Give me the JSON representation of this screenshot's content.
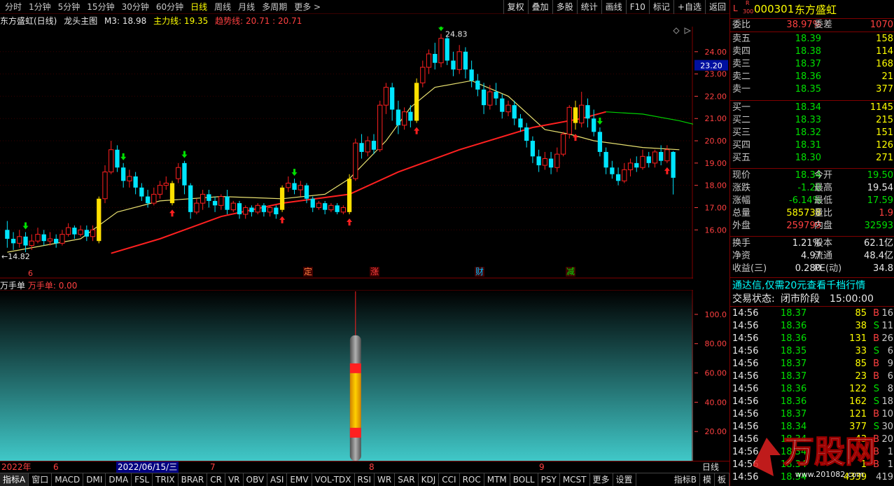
{
  "toolbar": {
    "periods": [
      "分时",
      "1分钟",
      "5分钟",
      "15分钟",
      "30分钟",
      "60分钟",
      "日线",
      "周线",
      "月线",
      "多周期",
      "更多 >"
    ],
    "active_period": 6,
    "tools": [
      "复权",
      "叠加",
      "多股",
      "统计",
      "画线",
      "F10",
      "标记",
      "+自选",
      "返回"
    ]
  },
  "main_title": {
    "stock": "东方盛虹(日线)",
    "template": "龙头主图",
    "m3": "M3: 18.98",
    "main_line": "主力线: 19.35",
    "trend_line": "趋势线: 20.71 : 20.71"
  },
  "kline": {
    "high_label": "24.83",
    "low_label": "←14.82",
    "price_axis": [
      "24.00",
      "23.00",
      "22.00",
      "21.00",
      "20.00",
      "19.00",
      "18.00",
      "17.00",
      "16.00"
    ],
    "current_price_tag": "23.20",
    "event_labels": [
      "定",
      "涨",
      "财",
      "减"
    ],
    "left_label": "6"
  },
  "indicator": {
    "name": "万手单",
    "value_label": "万手单: 0.00",
    "axis": [
      "100.0",
      "80.00",
      "60.00",
      "40.00",
      "20.00"
    ]
  },
  "datebar": {
    "items": [
      "2022年",
      "6",
      "2022/06/15/三",
      "7",
      "8",
      "9"
    ],
    "period": "日线"
  },
  "tabs": [
    "指标A",
    "窗口",
    "MACD",
    "DMI",
    "DMA",
    "FSL",
    "TRIX",
    "BRAR",
    "CR",
    "VR",
    "OBV",
    "ASI",
    "EMV",
    "VOL-TDX",
    "RSI",
    "WR",
    "SAR",
    "KDJ",
    "CCI",
    "ROC",
    "MTM",
    "BOLL",
    "PSY",
    "MCST",
    "更多",
    "设置"
  ],
  "tabs_right": [
    "指标B",
    "模",
    "板"
  ],
  "quote": {
    "badge_l": "L",
    "badge_r": "R",
    "badge_num": "300",
    "code": "000301",
    "name": "东方盛虹",
    "weibi_label": "委比",
    "weibi": "38.97%",
    "weicha_label": "委差",
    "weicha": "1070",
    "asks": [
      {
        "label": "卖五",
        "price": "18.39",
        "vol": "158"
      },
      {
        "label": "卖四",
        "price": "18.38",
        "vol": "114"
      },
      {
        "label": "卖三",
        "price": "18.37",
        "vol": "168"
      },
      {
        "label": "卖二",
        "price": "18.36",
        "vol": "21"
      },
      {
        "label": "卖一",
        "price": "18.35",
        "vol": "377"
      }
    ],
    "bids": [
      {
        "label": "买一",
        "price": "18.34",
        "vol": "1145"
      },
      {
        "label": "买二",
        "price": "18.33",
        "vol": "215"
      },
      {
        "label": "买三",
        "price": "18.32",
        "vol": "151"
      },
      {
        "label": "买四",
        "price": "18.31",
        "vol": "126"
      },
      {
        "label": "买五",
        "price": "18.30",
        "vol": "271"
      }
    ],
    "stats": [
      {
        "l1": "现价",
        "v1": "18.34",
        "c1": "green",
        "l2": "今开",
        "v2": "19.50",
        "c2": "green"
      },
      {
        "l1": "涨跌",
        "v1": "-1.20",
        "c1": "green",
        "l2": "最高",
        "v2": "19.54",
        "c2": "white"
      },
      {
        "l1": "涨幅",
        "v1": "-6.14%",
        "c1": "green",
        "l2": "最低",
        "v2": "17.59",
        "c2": "green"
      },
      {
        "l1": "总量",
        "v1": "585738",
        "c1": "yellow",
        "l2": "量比",
        "v2": "1.9",
        "c2": "red"
      },
      {
        "l1": "外盘",
        "v1": "259799",
        "c1": "red",
        "l2": "内盘",
        "v2": "32593",
        "c2": "green"
      }
    ],
    "stats2": [
      {
        "l1": "换手",
        "v1": "1.21%",
        "l2": "股本",
        "v2": "62.1亿"
      },
      {
        "l1": "净资",
        "v1": "4.97",
        "l2": "流通",
        "v2": "48.4亿"
      },
      {
        "l1": "收益(三)",
        "v1": "0.280",
        "l2": "PE(动)",
        "v2": "34.8"
      }
    ],
    "ad_text": "通达信,仅需20元查看千档行情",
    "status_label": "交易状态:",
    "status_value": "闭市阶段",
    "status_time": "15:00:00",
    "ticks": [
      {
        "t": "14:56",
        "p": "18.37",
        "v": "85",
        "d": "B",
        "n": "16"
      },
      {
        "t": "14:56",
        "p": "18.36",
        "v": "38",
        "d": "S",
        "n": "11"
      },
      {
        "t": "14:56",
        "p": "18.36",
        "v": "131",
        "d": "B",
        "n": "26"
      },
      {
        "t": "14:56",
        "p": "18.35",
        "v": "33",
        "d": "S",
        "n": "6"
      },
      {
        "t": "14:56",
        "p": "18.37",
        "v": "85",
        "d": "B",
        "n": "9"
      },
      {
        "t": "14:56",
        "p": "18.37",
        "v": "23",
        "d": "B",
        "n": "6"
      },
      {
        "t": "14:56",
        "p": "18.36",
        "v": "122",
        "d": "S",
        "n": "8"
      },
      {
        "t": "14:56",
        "p": "18.36",
        "v": "162",
        "d": "S",
        "n": "18"
      },
      {
        "t": "14:56",
        "p": "18.37",
        "v": "121",
        "d": "B",
        "n": "10"
      },
      {
        "t": "14:56",
        "p": "18.34",
        "v": "377",
        "d": "S",
        "n": "30"
      },
      {
        "t": "14:56",
        "p": "18.34",
        "v": "43",
        "d": "B",
        "n": "20"
      },
      {
        "t": "14:56",
        "p": "18.34",
        "v": "1",
        "d": "B",
        "n": "1"
      },
      {
        "t": "14:56",
        "p": "18.34",
        "v": "1",
        "d": "B",
        "n": "1"
      },
      {
        "t": "14:56",
        "p": "18.34",
        "v": "4339",
        "d": "",
        "n": "419"
      }
    ],
    "watermark": "万股网",
    "watermark_url": "www.201082.com"
  },
  "colors": {
    "up": "#ff2020",
    "down": "#00e5ff",
    "special": "#ffe000",
    "ma_yellow": "#e8e070",
    "ma_red": "#ff2020",
    "ma_green": "#00d000",
    "frame": "#800000"
  },
  "chart_data": {
    "type": "candlestick",
    "candles": [
      [
        16.0,
        15.6,
        16.4,
        15.2
      ],
      [
        15.6,
        15.4,
        15.9,
        15.1
      ],
      [
        15.4,
        15.7,
        16.0,
        15.2
      ],
      [
        15.7,
        15.3,
        15.9,
        15.0
      ],
      [
        15.3,
        15.5,
        15.8,
        15.1
      ],
      [
        15.5,
        15.8,
        16.1,
        15.4
      ],
      [
        15.8,
        15.5,
        16.0,
        15.3
      ],
      [
        15.5,
        15.6,
        15.9,
        15.3
      ],
      [
        15.6,
        15.4,
        15.8,
        15.2
      ],
      [
        15.4,
        15.8,
        16.0,
        15.3
      ],
      [
        15.8,
        16.1,
        16.3,
        15.7
      ],
      [
        16.1,
        15.8,
        16.2,
        15.6
      ],
      [
        15.8,
        16.0,
        16.2,
        15.7
      ],
      [
        16.0,
        15.7,
        16.2,
        15.5
      ],
      [
        15.7,
        16.0,
        16.2,
        15.5
      ],
      [
        15.5,
        17.4,
        17.5,
        15.4
      ],
      [
        17.4,
        18.6,
        18.9,
        17.2
      ],
      [
        18.6,
        19.6,
        20.0,
        18.5
      ],
      [
        19.6,
        18.8,
        19.8,
        18.6
      ],
      [
        18.8,
        18.2,
        19.0,
        17.9
      ],
      [
        18.2,
        18.4,
        18.7,
        17.9
      ],
      [
        18.4,
        17.9,
        18.6,
        17.6
      ],
      [
        17.9,
        17.5,
        18.1,
        17.3
      ],
      [
        17.5,
        17.2,
        17.8,
        17.0
      ],
      [
        17.2,
        17.6,
        17.9,
        17.1
      ],
      [
        17.6,
        18.0,
        18.2,
        17.4
      ],
      [
        18.0,
        18.1,
        18.4,
        17.8
      ],
      [
        17.2,
        18.1,
        18.2,
        17.1
      ],
      [
        18.3,
        18.8,
        19.0,
        18.1
      ],
      [
        19.0,
        18.0,
        19.1,
        17.6
      ],
      [
        18.0,
        16.8,
        18.1,
        16.5
      ],
      [
        16.8,
        17.2,
        17.4,
        16.7
      ],
      [
        17.2,
        17.6,
        17.8,
        16.9
      ],
      [
        17.6,
        17.3,
        17.8,
        17.0
      ],
      [
        17.3,
        17.1,
        17.5,
        16.8
      ],
      [
        17.1,
        17.5,
        17.6,
        16.9
      ],
      [
        17.5,
        16.9,
        17.8,
        16.7
      ],
      [
        16.9,
        17.2,
        17.3,
        16.8
      ],
      [
        17.2,
        16.7,
        17.3,
        16.5
      ],
      [
        16.7,
        17.0,
        17.1,
        16.5
      ],
      [
        17.0,
        16.8,
        17.1,
        16.6
      ],
      [
        16.8,
        17.1,
        17.2,
        16.7
      ],
      [
        17.1,
        16.8,
        17.2,
        16.6
      ],
      [
        16.8,
        17.0,
        17.1,
        16.6
      ],
      [
        17.0,
        16.7,
        17.1,
        16.5
      ],
      [
        16.9,
        17.9,
        18.0,
        16.8
      ],
      [
        17.9,
        18.1,
        18.4,
        17.7
      ],
      [
        18.1,
        17.8,
        18.3,
        17.6
      ],
      [
        17.8,
        18.0,
        18.2,
        17.5
      ],
      [
        18.0,
        17.4,
        18.1,
        17.2
      ],
      [
        17.4,
        17.0,
        17.5,
        16.8
      ],
      [
        17.0,
        17.2,
        17.3,
        16.9
      ],
      [
        17.2,
        16.9,
        17.3,
        16.7
      ],
      [
        16.9,
        17.1,
        17.2,
        16.8
      ],
      [
        17.1,
        16.8,
        17.2,
        16.7
      ],
      [
        16.8,
        17.0,
        17.1,
        16.7
      ],
      [
        16.8,
        18.3,
        18.5,
        16.7
      ],
      [
        18.3,
        19.9,
        20.1,
        18.2
      ],
      [
        19.9,
        19.5,
        20.3,
        19.2
      ],
      [
        19.5,
        20.0,
        20.2,
        19.3
      ],
      [
        20.0,
        19.6,
        20.3,
        19.4
      ],
      [
        19.6,
        21.6,
        21.8,
        19.5
      ],
      [
        21.6,
        22.4,
        22.6,
        21.2
      ],
      [
        22.4,
        21.4,
        22.6,
        20.9
      ],
      [
        21.4,
        20.7,
        21.8,
        20.3
      ],
      [
        20.7,
        21.3,
        21.5,
        20.5
      ],
      [
        21.3,
        20.9,
        21.6,
        20.6
      ],
      [
        20.9,
        22.6,
        22.8,
        20.8
      ],
      [
        22.6,
        23.3,
        23.6,
        22.4
      ],
      [
        23.3,
        23.9,
        24.1,
        23.0
      ],
      [
        23.9,
        23.5,
        24.4,
        23.2
      ],
      [
        23.5,
        24.6,
        24.8,
        23.3
      ],
      [
        24.6,
        23.6,
        24.7,
        23.4
      ],
      [
        23.6,
        23.2,
        24.0,
        22.9
      ],
      [
        23.2,
        24.0,
        24.3,
        23.0
      ],
      [
        24.0,
        23.2,
        24.2,
        22.8
      ],
      [
        23.2,
        22.7,
        23.6,
        22.4
      ],
      [
        22.7,
        22.3,
        23.0,
        22.0
      ],
      [
        22.3,
        21.6,
        22.6,
        21.2
      ],
      [
        21.6,
        22.2,
        22.5,
        21.4
      ],
      [
        22.2,
        21.9,
        22.6,
        21.6
      ],
      [
        21.9,
        21.3,
        22.1,
        21.0
      ],
      [
        21.3,
        21.6,
        21.8,
        21.1
      ],
      [
        21.6,
        21.0,
        21.8,
        20.7
      ],
      [
        21.0,
        20.6,
        21.2,
        20.4
      ],
      [
        20.6,
        20.0,
        20.8,
        19.7
      ],
      [
        20.0,
        19.3,
        20.2,
        19.0
      ],
      [
        19.3,
        18.9,
        19.6,
        18.6
      ],
      [
        18.9,
        19.2,
        19.5,
        18.7
      ],
      [
        19.2,
        18.8,
        19.5,
        18.5
      ],
      [
        18.8,
        19.4,
        19.7,
        18.6
      ],
      [
        19.4,
        20.3,
        20.4,
        19.3
      ],
      [
        20.3,
        21.5,
        21.6,
        20.1
      ],
      [
        21.5,
        20.8,
        21.8,
        20.5
      ],
      [
        20.8,
        21.6,
        22.2,
        20.6
      ],
      [
        21.6,
        21.0,
        21.9,
        20.6
      ],
      [
        21.0,
        20.4,
        21.4,
        20.2
      ],
      [
        20.4,
        19.5,
        20.6,
        19.3
      ],
      [
        19.5,
        18.8,
        19.7,
        18.5
      ],
      [
        18.8,
        18.5,
        19.1,
        18.3
      ],
      [
        18.5,
        18.2,
        18.8,
        18.0
      ],
      [
        18.2,
        18.7,
        19.0,
        18.1
      ],
      [
        18.7,
        19.0,
        19.2,
        18.4
      ],
      [
        19.0,
        18.8,
        19.3,
        18.6
      ],
      [
        18.8,
        19.3,
        19.6,
        18.7
      ],
      [
        19.3,
        19.0,
        19.5,
        18.8
      ],
      [
        19.0,
        19.5,
        19.6,
        18.8
      ],
      [
        19.5,
        19.1,
        19.8,
        18.9
      ],
      [
        19.1,
        19.6,
        19.8,
        19.0
      ],
      [
        19.5,
        18.34,
        19.54,
        17.59
      ]
    ],
    "special_bars": [
      15,
      27,
      45,
      56,
      67,
      93
    ],
    "ma_yellow": [
      [
        0,
        15.0
      ],
      [
        12,
        15.6
      ],
      [
        18,
        16.8
      ],
      [
        25,
        17.3
      ],
      [
        35,
        17.5
      ],
      [
        45,
        17.4
      ],
      [
        52,
        17.6
      ],
      [
        56,
        18.3
      ],
      [
        62,
        20.0
      ],
      [
        66,
        21.5
      ],
      [
        70,
        22.4
      ],
      [
        76,
        22.7
      ],
      [
        82,
        22.0
      ],
      [
        88,
        20.5
      ],
      [
        92,
        20.3
      ],
      [
        96,
        20.0
      ],
      [
        104,
        19.7
      ],
      [
        110,
        19.6
      ]
    ],
    "ma_red": [
      [
        17,
        14.95
      ],
      [
        25,
        15.6
      ],
      [
        35,
        16.6
      ],
      [
        45,
        17.2
      ],
      [
        56,
        17.6
      ],
      [
        64,
        18.6
      ],
      [
        74,
        19.6
      ],
      [
        86,
        20.6
      ],
      [
        94,
        21.0
      ],
      [
        98,
        21.3
      ]
    ],
    "ma_green": [
      [
        98,
        21.3
      ],
      [
        104,
        21.2
      ],
      [
        110,
        20.9
      ],
      [
        113,
        20.7
      ]
    ],
    "ylim": [
      14.5,
      25.0
    ],
    "indicator": {
      "type": "bar",
      "bar_index": 57,
      "value": 100
    }
  }
}
